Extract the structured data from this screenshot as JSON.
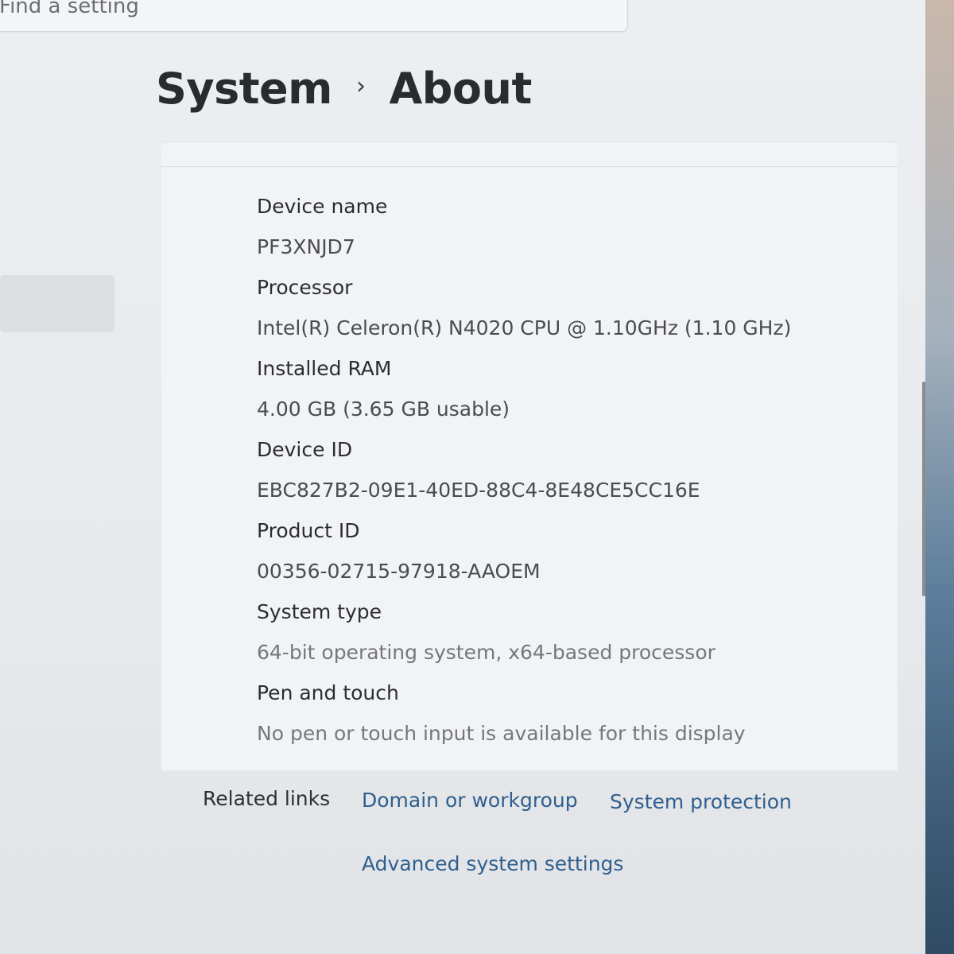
{
  "search": {
    "placeholder": "Find a setting"
  },
  "header": {
    "breadcrumb_parent": "System",
    "breadcrumb_separator": "›",
    "breadcrumb_current": "About"
  },
  "specs": [
    {
      "label": "Device name",
      "value": "PF3XNJD7"
    },
    {
      "label": "Processor",
      "value": "Intel(R) Celeron(R) N4020 CPU @ 1.10GHz (1.10 GHz)"
    },
    {
      "label": "Installed RAM",
      "value": "4.00 GB (3.65 GB usable)"
    },
    {
      "label": "Device ID",
      "value": "EBC827B2-09E1-40ED-88C4-8E48CE5CC16E"
    },
    {
      "label": "Product ID",
      "value": "00356-02715-97918-AAOEM"
    },
    {
      "label": "System type",
      "value": "64-bit operating system, x64-based processor"
    },
    {
      "label": "Pen and touch",
      "value": "No pen or touch input is available for this display"
    }
  ],
  "related": {
    "label": "Related links",
    "links": [
      "Domain or workgroup",
      "System protection",
      "Advanced system settings"
    ]
  },
  "colors": {
    "link": "#2f5f8f",
    "panel_bg": "#f2f3f5",
    "title": "#2a2b2d"
  }
}
